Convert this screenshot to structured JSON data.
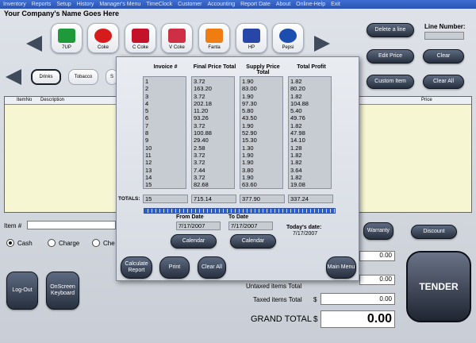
{
  "menu": [
    "Inventory",
    "Reports",
    "Setup",
    "History",
    "Manager's Menu",
    "TimeClock",
    "Customer",
    "Accounting",
    "Report Date",
    "About",
    "Online-Help",
    "Exit"
  ],
  "company": "Your Company's Name Goes Here",
  "products": [
    {
      "label": "7UP",
      "color": "#1f9a3b"
    },
    {
      "label": "Coke",
      "color": "#d51b1b"
    },
    {
      "label": "C Coke",
      "color": "#c4122b"
    },
    {
      "label": "V Coke",
      "color": "#cf2f45"
    },
    {
      "label": "Fanta",
      "color": "#f07d12"
    },
    {
      "label": "HP",
      "color": "#2746a8"
    },
    {
      "label": "Pepsi",
      "color": "#1c4db0"
    }
  ],
  "categories": [
    "Drinks",
    "Tobacco",
    "S"
  ],
  "right_buttons": {
    "delete_line": "Delete a line",
    "edit_price": "Edit Price",
    "clear": "Clear",
    "custom_item": "Custom Item",
    "clear_all": "Clear All",
    "line_number_label": "Line Number:"
  },
  "grid": {
    "columns": [
      "ItemNo",
      "Description",
      "Price"
    ]
  },
  "item_label": "Item #",
  "payment": {
    "cash": "Cash",
    "charge": "Charge",
    "check": "Che"
  },
  "buttons": {
    "warranty": "Warranty",
    "discount": "Discount",
    "logout": "Log-Out",
    "onscreen_keyboard": "OnScreen Keyboard",
    "tender": "TENDER"
  },
  "totals": {
    "row1_value": "0.00",
    "row2_label": "Untaxed items Total",
    "row2_value": "0.00",
    "taxed_label": "Taxed items Total",
    "taxed_currency": "$",
    "taxed_value": "0.00",
    "grand_label": "GRAND TOTAL",
    "grand_currency": "$",
    "grand_value": "0.00"
  },
  "report": {
    "headers": [
      "Invoice #",
      "Final Price Total",
      "Supply Price Total",
      "Total Profit"
    ],
    "invoice": [
      "1",
      "2",
      "3",
      "4",
      "5",
      "6",
      "7",
      "8",
      "9",
      "10",
      "11",
      "12",
      "13",
      "14",
      "15"
    ],
    "final_price": [
      "3.72",
      "163.20",
      "3.72",
      "202.18",
      "11.20",
      "93.26",
      "3.72",
      "100.88",
      "29.40",
      "2.58",
      "3.72",
      "3.72",
      "7.44",
      "3.72",
      "82.68"
    ],
    "supply_price": [
      "1.90",
      "83.00",
      "1.90",
      "97.30",
      "5.80",
      "43.50",
      "1.90",
      "52.90",
      "15.30",
      "1.30",
      "1.90",
      "1.90",
      "3.80",
      "1.90",
      "63.60"
    ],
    "profit": [
      "1.82",
      "80.20",
      "1.82",
      "104.88",
      "5.40",
      "49.76",
      "1.82",
      "47.98",
      "14.10",
      "1.28",
      "1.82",
      "1.82",
      "3.64",
      "1.82",
      "19.08"
    ],
    "totals_label": "TOTALS:",
    "totals": [
      "15",
      "715.14",
      "377.90",
      "337.24"
    ],
    "from_date_label": "From Date",
    "from_date": "7/17/2007",
    "to_date_label": "To Date",
    "to_date": "7/17/2007",
    "todays_date_label": "Today's date:",
    "todays_date": "7/17/2007",
    "calendar1": "Calendar",
    "calendar2": "Calendar",
    "calculate": "Calculate Report",
    "print": "Print",
    "clear_all": "Clear All",
    "main_menu": "Main Menu"
  }
}
